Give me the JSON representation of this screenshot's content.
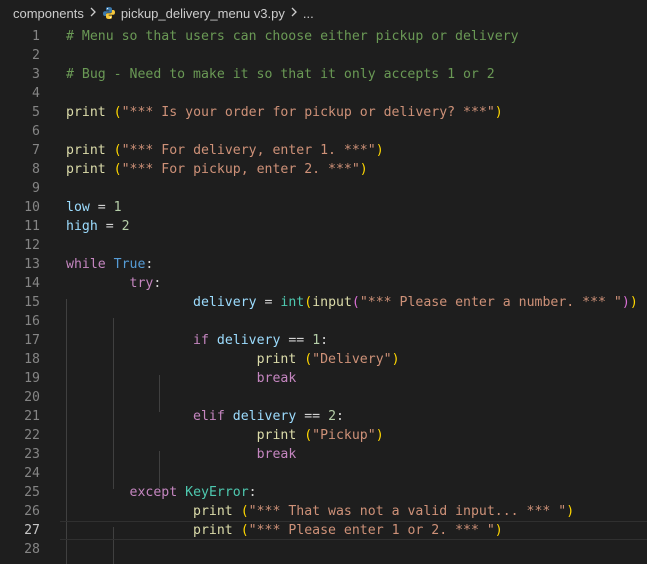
{
  "breadcrumb": {
    "folder": "components",
    "file": "pickup_delivery_menu v3.py",
    "ellipsis": "..."
  },
  "icons": {
    "separator": "chevron-right-icon",
    "file": "python-file-icon"
  },
  "colors": {
    "background": "#1e1e1e",
    "comment": "#6a9955",
    "function": "#dcdcaa",
    "string": "#ce9178",
    "number": "#b5cea8",
    "variable": "#9cdcfe",
    "keyword_control": "#c586c0",
    "keyword_const": "#569cd6",
    "class": "#4ec9b0"
  },
  "editor": {
    "active_line": 27,
    "lines": [
      {
        "n": "1",
        "tokens": [
          [
            "c",
            "# Menu so that users can choose either pickup or delivery"
          ]
        ]
      },
      {
        "n": "2",
        "tokens": []
      },
      {
        "n": "3",
        "tokens": [
          [
            "c",
            "# Bug - Need to make it so that it only accepts 1 or 2"
          ]
        ]
      },
      {
        "n": "4",
        "tokens": []
      },
      {
        "n": "5",
        "tokens": [
          [
            "f",
            "print"
          ],
          [
            "o",
            " "
          ],
          [
            "b1",
            "("
          ],
          [
            "s",
            "\"*** Is your order for pickup or delivery? ***\""
          ],
          [
            "b1",
            ")"
          ]
        ]
      },
      {
        "n": "6",
        "tokens": []
      },
      {
        "n": "7",
        "tokens": [
          [
            "f",
            "print"
          ],
          [
            "o",
            " "
          ],
          [
            "b1",
            "("
          ],
          [
            "s",
            "\"*** For delivery, enter 1. ***\""
          ],
          [
            "b1",
            ")"
          ]
        ]
      },
      {
        "n": "8",
        "tokens": [
          [
            "f",
            "print"
          ],
          [
            "o",
            " "
          ],
          [
            "b1",
            "("
          ],
          [
            "s",
            "\"*** For pickup, enter 2. ***\""
          ],
          [
            "b1",
            ")"
          ]
        ]
      },
      {
        "n": "9",
        "tokens": []
      },
      {
        "n": "10",
        "tokens": [
          [
            "v",
            "low"
          ],
          [
            "o",
            " = "
          ],
          [
            "n",
            "1"
          ]
        ]
      },
      {
        "n": "11",
        "tokens": [
          [
            "v",
            "high"
          ],
          [
            "o",
            " = "
          ],
          [
            "n",
            "2"
          ]
        ]
      },
      {
        "n": "12",
        "tokens": []
      },
      {
        "n": "13",
        "tokens": [
          [
            "k",
            "while"
          ],
          [
            "o",
            " "
          ],
          [
            "k2",
            "True"
          ],
          [
            "o",
            ":"
          ]
        ]
      },
      {
        "n": "14",
        "tokens": [
          [
            "o",
            "        "
          ],
          [
            "k",
            "try"
          ],
          [
            "o",
            ":"
          ]
        ]
      },
      {
        "n": "15",
        "tokens": [
          [
            "o",
            "                "
          ],
          [
            "v",
            "delivery"
          ],
          [
            "o",
            " = "
          ],
          [
            "cl",
            "int"
          ],
          [
            "b1",
            "("
          ],
          [
            "f",
            "input"
          ],
          [
            "b2",
            "("
          ],
          [
            "s",
            "\"*** Please enter a number. *** \""
          ],
          [
            "b2",
            ")"
          ],
          [
            "b1",
            ")"
          ]
        ]
      },
      {
        "n": "16",
        "tokens": []
      },
      {
        "n": "17",
        "tokens": [
          [
            "o",
            "                "
          ],
          [
            "k",
            "if"
          ],
          [
            "o",
            " "
          ],
          [
            "v",
            "delivery"
          ],
          [
            "o",
            " == "
          ],
          [
            "n",
            "1"
          ],
          [
            "o",
            ":"
          ]
        ]
      },
      {
        "n": "18",
        "tokens": [
          [
            "o",
            "                        "
          ],
          [
            "f",
            "print"
          ],
          [
            "o",
            " "
          ],
          [
            "b1",
            "("
          ],
          [
            "s",
            "\"Delivery\""
          ],
          [
            "b1",
            ")"
          ]
        ]
      },
      {
        "n": "19",
        "tokens": [
          [
            "o",
            "                        "
          ],
          [
            "k",
            "break"
          ]
        ]
      },
      {
        "n": "20",
        "tokens": []
      },
      {
        "n": "21",
        "tokens": [
          [
            "o",
            "                "
          ],
          [
            "k",
            "elif"
          ],
          [
            "o",
            " "
          ],
          [
            "v",
            "delivery"
          ],
          [
            "o",
            " == "
          ],
          [
            "n",
            "2"
          ],
          [
            "o",
            ":"
          ]
        ]
      },
      {
        "n": "22",
        "tokens": [
          [
            "o",
            "                        "
          ],
          [
            "f",
            "print"
          ],
          [
            "o",
            " "
          ],
          [
            "b1",
            "("
          ],
          [
            "s",
            "\"Pickup\""
          ],
          [
            "b1",
            ")"
          ]
        ]
      },
      {
        "n": "23",
        "tokens": [
          [
            "o",
            "                        "
          ],
          [
            "k",
            "break"
          ]
        ]
      },
      {
        "n": "24",
        "tokens": []
      },
      {
        "n": "25",
        "tokens": [
          [
            "o",
            "        "
          ],
          [
            "k",
            "except"
          ],
          [
            "o",
            " "
          ],
          [
            "cl",
            "KeyError"
          ],
          [
            "o",
            ":"
          ]
        ]
      },
      {
        "n": "26",
        "tokens": [
          [
            "o",
            "                "
          ],
          [
            "f",
            "print"
          ],
          [
            "o",
            " "
          ],
          [
            "b1",
            "("
          ],
          [
            "s",
            "\"*** That was not a valid input... *** \""
          ],
          [
            "b1",
            ")"
          ]
        ]
      },
      {
        "n": "27",
        "tokens": [
          [
            "o",
            "                "
          ],
          [
            "f",
            "print"
          ],
          [
            "o",
            " "
          ],
          [
            "b1",
            "("
          ],
          [
            "s",
            "\"*** Please enter 1 or 2. *** \""
          ],
          [
            "b1",
            ")"
          ]
        ]
      },
      {
        "n": "28",
        "tokens": []
      }
    ]
  }
}
